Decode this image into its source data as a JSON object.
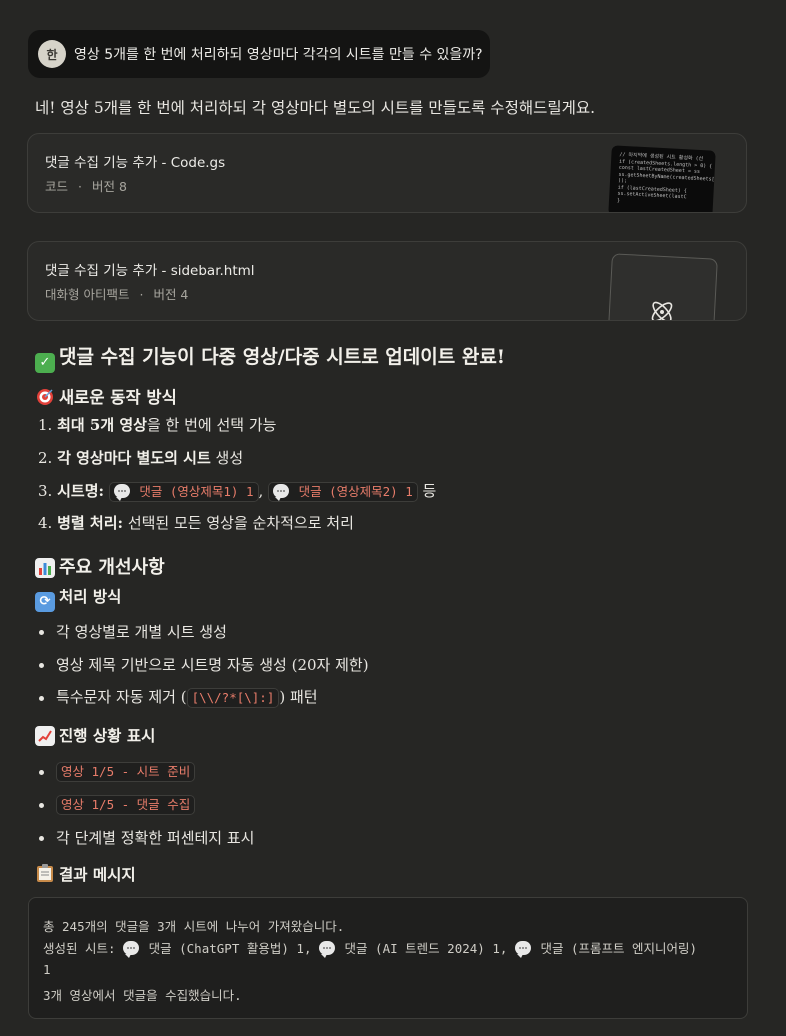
{
  "user_message": {
    "avatar": "한",
    "text": "영상 5개를 한 번에 처리하되 영상마다 각각의 시트를 만들 수 있을까?"
  },
  "intro": "네! 영상 5개를 한 번에 처리하되 각 영상마다 별도의 시트를 만들도록 수정해드릴게요.",
  "artifacts": [
    {
      "title": "댓글 수집 기능 추가 - Code.gs",
      "type": "코드",
      "version": "버전 8",
      "thumb_icon": "code-thumbnail"
    },
    {
      "title": "댓글 수집 기능 추가 - sidebar.html",
      "type": "대화형 아티팩트",
      "version": "버전 4",
      "thumb_icon": "atom-icon"
    }
  ],
  "separator": "·",
  "thumb_code_lines": [
    "// 마지막에 생성된 시트 활성화 (선",
    "if (createdSheets.length > 0) {",
    "  const lastCreatedSheet = ss",
    "ss.getSheetByName(createdSheets[",
    "  ));",
    "  if (lastCreatedSheet) {",
    "    ss.setActiveSheet(lastC",
    "  }"
  ],
  "heading_main": "댓글 수집 기능이 다중 영상/다중 시트로 업데이트 완료!",
  "section_new": {
    "title": "새로운 동작 방식",
    "items": [
      {
        "num": "1.",
        "bold": "최대 5개 영상",
        "rest": "을 한 번에 선택 가능"
      },
      {
        "num": "2.",
        "bold": "각 영상마다 별도의 시트",
        "rest": " 생성"
      },
      {
        "num": "3.",
        "bold": "시트명:",
        "chip1": "댓글 (영상제목1) 1",
        "comma": ",",
        "chip2": "댓글 (영상제목2) 1",
        "rest": "등"
      },
      {
        "num": "4.",
        "bold": "병렬 처리:",
        "rest": " 선택된 모든 영상을 순차적으로 처리"
      }
    ]
  },
  "section_improve": {
    "title": "주요 개선사항"
  },
  "section_process": {
    "title": "처리 방식",
    "items": [
      "각 영상별로 개별 시트 생성",
      "영상 제목 기반으로 시트명 자동 생성 (20자 제한)",
      {
        "pre": "특수문자 자동 제거 (",
        "chip": "[\\\\/?*[\\]:]",
        "post": ") 패턴"
      }
    ]
  },
  "section_progress": {
    "title": "진행 상황 표시",
    "items": [
      "영상 1/5 - 시트 준비",
      "영상 1/5 - 댓글 수집",
      "각 단계별 정확한 퍼센테지 표시"
    ]
  },
  "section_result": {
    "title": "결과 메시지",
    "lines": {
      "l1": "총 245개의 댓글을 3개 시트에 나누어 가져왔습니다.",
      "l2_prefix": "생성된 시트: ",
      "sheet1": "댓글 (ChatGPT 활용법) 1,",
      "sheet2": "댓글 (AI 트렌드 2024) 1,",
      "sheet3": "댓글 (프롬프트 엔지니어링)",
      "l3": "1",
      "l4": "3개 영상에서 댓글을 수집했습니다."
    }
  },
  "colors": {
    "background": "#262624",
    "chip_text": "#e77c6a",
    "check_green": "#4cae4f"
  }
}
